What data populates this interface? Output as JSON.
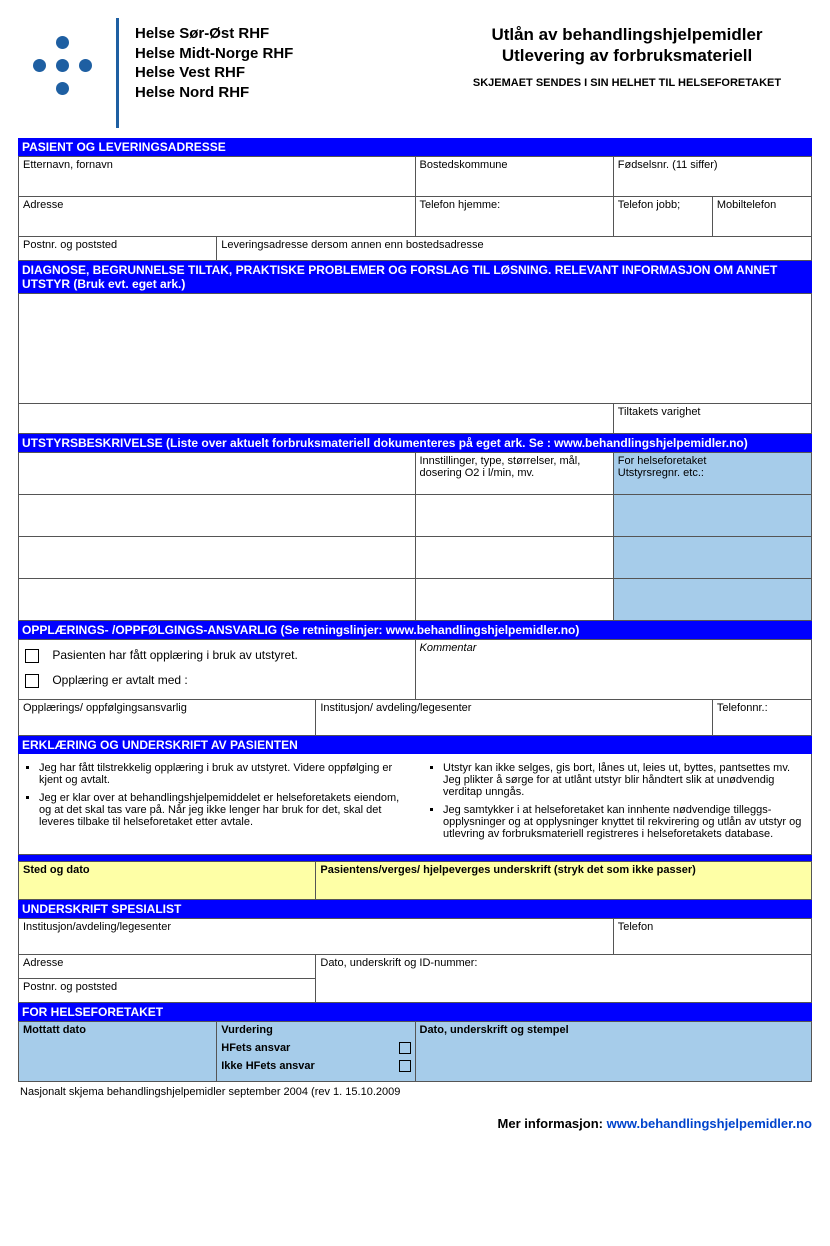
{
  "header": {
    "org1": "Helse Sør-Øst RHF",
    "org2": "Helse Midt-Norge RHF",
    "org3": "Helse Vest RHF",
    "org4": "Helse Nord RHF",
    "title1": "Utlån av behandlingshjelpemidler",
    "title2": "Utlevering av forbruksmateriell",
    "subtitle": "SKJEMAET SENDES I SIN HELHET  TIL HELSEFORETAKET"
  },
  "sections": {
    "pasient": "PASIENT OG LEVERINGSADRESSE",
    "diagnose": "DIAGNOSE, BEGRUNNELSE TILTAK, PRAKTISKE PROBLEMER OG FORSLAG TIL LØSNING. RELEVANT INFORMASJON OM ANNET UTSTYR (Bruk evt. eget ark.)",
    "utstyr": "UTSTYRSBESKRIVELSE  (Liste over aktuelt forbruksmateriell dokumenteres på eget ark. Se : www.behandlingshjelpemidler.no)",
    "opplaering": "OPPLÆRINGS- /OPPFØLGINGS-ANSVARLIG  (Se retningslinjer:  www.behandlingshjelpemidler.no)",
    "erklaring": "ERKLÆRING OG UNDERSKRIFT AV PASIENTEN",
    "underskrift": "UNDERSKRIFT SPESIALIST",
    "helseforetaket": "FOR HELSEFORETAKET"
  },
  "labels": {
    "etternavn": "Etternavn,  fornavn",
    "bostedskommune": "Bostedskommune",
    "fodselsnr": "Fødselsnr. (11 siffer)",
    "adresse": "Adresse",
    "tlf_hjemme": "Telefon hjemme:",
    "tlf_jobb": "Telefon jobb;",
    "mobil": "Mobiltelefon",
    "postnr": "Postnr. og poststed",
    "leveringsadr": "Leveringsadresse dersom annen enn bostedsadresse",
    "tiltakets_varighet": "Tiltakets varighet",
    "innstillinger": "Innstillinger, type, størrelser, mål, dosering O2 i l/min, mv.",
    "for_helseforetaket": "For helseforetaket\nUtstyrsregnr. etc.:",
    "opplaering_faatt": "Pasienten har fått opplæring i bruk av utstyret.",
    "opplaering_avtalt": "Opplæring er avtalt med :",
    "kommentar": "Kommentar",
    "opplaeringsansvarlig": "Opplærings/ oppfølgingsansvarlig",
    "institusjon_avd": "Institusjon/ avdeling/legesenter",
    "telefonnr": "Telefonnr.:",
    "sted_dato": "Sted og dato",
    "pasient_underskrift": "Pasientens/verges/ hjelpeverges  underskrift (stryk det som ikke passer)",
    "institusjon": "Institusjon/avdeling/legesenter",
    "telefon": "Telefon",
    "adresse2": "Adresse",
    "dato_underskrift_id": "Dato, underskrift og ID-nummer:",
    "postnr2": "Postnr. og poststed",
    "mottatt_dato": "Mottatt dato",
    "vurdering": "Vurdering",
    "hfets_ansvar": "HFets ansvar",
    "ikke_hfets_ansvar": "Ikke HFets ansvar",
    "dato_underskrift_stempel": "Dato, underskrift og stempel"
  },
  "erklaring": {
    "li1": "Jeg har fått tilstrekkelig opplæring i bruk av utstyret. Videre oppfølging er kjent og avtalt.",
    "li2": "Jeg er klar over at behandlingshjelpemiddelet er helseforetakets eiendom, og at det skal tas vare på. Når jeg ikke lenger har bruk for det, skal det leveres tilbake til helseforetaket etter avtale.",
    "li3": "Utstyr kan ikke selges, gis bort, lånes ut, leies ut, byttes, pantsettes mv. Jeg plikter å sørge for at utlånt utstyr blir håndtert slik at unødvendig verditap unngås.",
    "li4": "Jeg samtykker i at helseforetaket kan innhente nødvendige tilleggs­opplysninger og at opplysninger knyttet til rekvirering og utlån av utstyr og utlevring av forbruksmateriell registreres i helseforetakets database."
  },
  "footer": {
    "note": "Nasjonalt skjema behandlingshjelpemidler september 2004 (rev 1. 15.10.2009",
    "more_info_label": "Mer informasjon: ",
    "more_info_link": "www.behandlingshjelpemidler.no"
  }
}
